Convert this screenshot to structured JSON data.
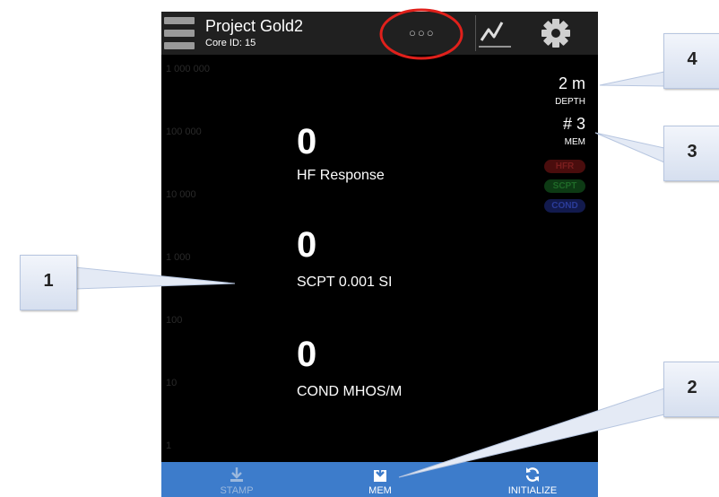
{
  "header": {
    "project_title": "Project Gold2",
    "core_id": "Core ID: 15",
    "dots": "○○○"
  },
  "axis_labels": [
    "1 000 000",
    "100 000",
    "10 000",
    "1 000",
    "100",
    "10",
    "1"
  ],
  "readings": [
    {
      "value": "0",
      "label": "HF Response"
    },
    {
      "value": "0",
      "label": "SCPT 0.001 SI"
    },
    {
      "value": "0",
      "label": "COND MHOS/M"
    }
  ],
  "status": {
    "depth_value": "2 m",
    "depth_label": "DEPTH",
    "mem_value": "# 3",
    "mem_label": "MEM"
  },
  "badges": {
    "hfr": "HFR",
    "scpt": "SCPT",
    "cond": "COND"
  },
  "bottom_bar": {
    "stamp_label": "STAMP",
    "mem_label": "MEM",
    "initialize_label": "INITIALIZE"
  },
  "callouts": [
    "1",
    "2",
    "3",
    "4"
  ],
  "colors": {
    "topbar": "#202020",
    "background": "#000000",
    "bottombar": "#3d7ccb",
    "highlight_circle": "#e0201b",
    "hfr_badge": "#4a0d0d",
    "scpt_badge": "#0d3a14",
    "cond_badge": "#121a4d"
  }
}
